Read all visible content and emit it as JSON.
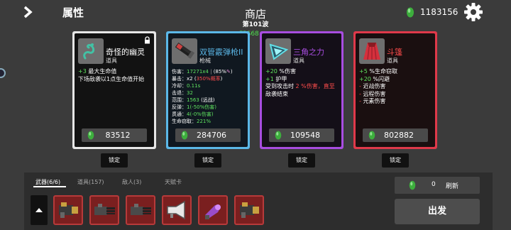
{
  "header": {
    "section_title": "属性",
    "shop_title": "商店",
    "wave": "第101波",
    "fps": "FPS68",
    "money": "1183156"
  },
  "cards": [
    {
      "name": "奇怪的幽灵",
      "type": "道具",
      "icon": "ghost-icon",
      "border_color": "#e6e6e6",
      "name_color": "#ffffff",
      "desc_line1_a": "+3",
      "desc_line1_b": " 最大生命值",
      "desc_line2": "下场敌袭以1点生命值开始",
      "price": "83512",
      "lock": "锁定"
    },
    {
      "name": "双管霰弹枪II",
      "type": "枪械",
      "icon": "shotgun-icon",
      "border_color": "#5bb8e8",
      "name_color": "#5bb8e8",
      "stats": {
        "damage_label": "伤害：",
        "damage_value": "17271x4",
        "damage_extra": "(85%",
        "crit_label": "暴击：x2 (",
        "crit_value": "350%概率",
        "crit_end": ")",
        "cooldown_label": "冷却：",
        "cooldown_value": "0.11s",
        "knockback_label": "击退：",
        "knockback_value": "32",
        "range_label": "范围：",
        "range_value": "1563",
        "range_extra": "(远战)",
        "bounce_label": "反弹：",
        "bounce_value": "1(-50%伤害)",
        "pierce_label": "贯通：",
        "pierce_value": "4(-0%伤害)",
        "lifesteal_label": "生命窃取：",
        "lifesteal_value": "221%"
      },
      "price": "284706",
      "lock": "锁定"
    },
    {
      "name": "三角之力",
      "type": "道具",
      "icon": "triangle-icon",
      "border_color": "#a84de0",
      "name_color": "#a84de0",
      "desc_line1_a": "+20",
      "desc_line1_b": " %伤害",
      "desc_line2_a": "+1",
      "desc_line2_b": " 护甲",
      "desc_line3_a": "受到攻击时 ",
      "desc_line3_b": "2",
      "desc_line3_c": " %伤害，直至",
      "desc_line4": "敌袭结束",
      "price": "109548",
      "lock": "锁定"
    },
    {
      "name": "斗篷",
      "type": "道具",
      "icon": "cloak-icon",
      "border_color": "#e0394a",
      "name_color": "#ff4c4c",
      "desc_line1_a": "+5",
      "desc_line1_b": " %生命窃取",
      "desc_line2_a": "+20",
      "desc_line2_b": " %闪避",
      "desc_line3_a": "-",
      "desc_line3_b": "近战伤害",
      "desc_line4_a": "-",
      "desc_line4_b": "远程伤害",
      "desc_line5_a": "-",
      "desc_line5_b": "元素伤害",
      "price": "802882",
      "lock": "锁定"
    }
  ],
  "tabs": {
    "weapons": "武器(6/6)",
    "items": "道具(157)",
    "enemies": "敌人(3)",
    "talents": "天赋卡"
  },
  "weapon_slots": [
    "gatling-icon",
    "minigun-icon",
    "minigun-icon",
    "megaphone-icon",
    "plasma-gun-icon",
    "gatling-icon"
  ],
  "refresh": {
    "count": "0",
    "label": "刷新"
  },
  "start_label": "出发"
}
